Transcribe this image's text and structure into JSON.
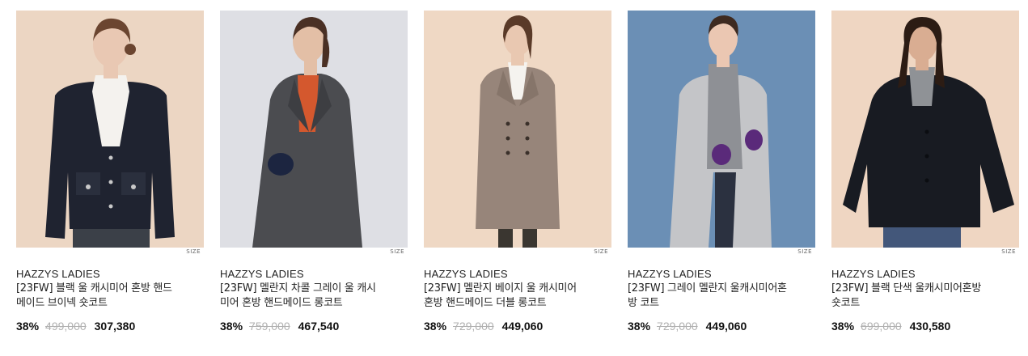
{
  "products": [
    {
      "brand": "HAZZYS LADIES",
      "name_line1": "[23FW] 블랙 울 캐시미어 혼방 핸드",
      "name_line2": "메이드 브이넥 숏코트",
      "discount": "38%",
      "original_price": "499,000",
      "sale_price": "307,380",
      "size_label": "SIZE",
      "colors": {
        "background": "#ecd6c3",
        "coat": "#1f2330",
        "inner": "#f4f2ee",
        "skin": "#e9c8b3",
        "hair": "#6b4530"
      }
    },
    {
      "brand": "HAZZYS LADIES",
      "name_line1": "[23FW] 멜란지 차콜 그레이 울 캐시",
      "name_line2": "미어 혼방 핸드메이드 롱코트",
      "discount": "38%",
      "original_price": "759,000",
      "sale_price": "467,540",
      "size_label": "SIZE",
      "colors": {
        "background": "#dedfe4",
        "coat": "#4b4c50",
        "inner": "#d4582e",
        "skin": "#e3bfa6",
        "hair": "#4a3024"
      }
    },
    {
      "brand": "HAZZYS LADIES",
      "name_line1": "[23FW] 멜란지 베이지 울 캐시미어",
      "name_line2": "혼방 핸드메이드 더블 롱코트",
      "discount": "38%",
      "original_price": "729,000",
      "sale_price": "449,060",
      "size_label": "SIZE",
      "colors": {
        "background": "#efd8c4",
        "coat": "#97857a",
        "inner": "#f5f3ef",
        "skin": "#e9c8b1",
        "hair": "#5a3a28"
      }
    },
    {
      "brand": "HAZZYS LADIES",
      "name_line1": "[23FW] 그레이 멜란지 울캐시미어혼",
      "name_line2": "방 코트",
      "discount": "38%",
      "original_price": "729,000",
      "sale_price": "449,060",
      "size_label": "SIZE",
      "colors": {
        "background": "#6b8fb5",
        "coat": "#c4c5c8",
        "inner": "#8e9095",
        "skin": "#ebc7b2",
        "hair": "#3e2a20"
      }
    },
    {
      "brand": "HAZZYS LADIES",
      "name_line1": "[23FW] 블랙 단색 울캐시미어혼방",
      "name_line2": "숏코트",
      "discount": "38%",
      "original_price": "699,000",
      "sale_price": "430,580",
      "size_label": "SIZE",
      "colors": {
        "background": "#efd6c2",
        "coat": "#181b22",
        "inner": "#8f9296",
        "skin": "#d9ad92",
        "hair": "#2c1c14"
      }
    }
  ]
}
